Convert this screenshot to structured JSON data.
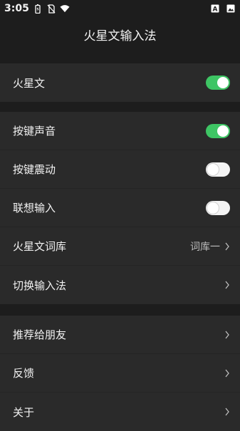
{
  "status_bar": {
    "time": "3:05",
    "icons": [
      "battery-saver-icon",
      "no-sim-icon",
      "wifi-icon",
      "text-notification-icon",
      "image-notification-icon"
    ]
  },
  "header": {
    "title": "火星文输入法"
  },
  "sections": [
    {
      "items": [
        {
          "label": "火星文",
          "type": "toggle",
          "state": "on"
        }
      ]
    },
    {
      "items": [
        {
          "label": "按键声音",
          "type": "toggle",
          "state": "on"
        },
        {
          "label": "按键震动",
          "type": "toggle",
          "state": "off"
        },
        {
          "label": "联想输入",
          "type": "toggle",
          "state": "off"
        },
        {
          "label": "火星文词库",
          "type": "nav",
          "value": "词库一"
        },
        {
          "label": "切换输入法",
          "type": "nav"
        }
      ]
    },
    {
      "items": [
        {
          "label": "推荐给朋友",
          "type": "nav"
        },
        {
          "label": "反馈",
          "type": "nav"
        },
        {
          "label": "关于",
          "type": "nav"
        }
      ]
    }
  ],
  "colors": {
    "background": "#1d1d1d",
    "section": "#2a2a2a",
    "toggle_on": "#3ec564"
  }
}
